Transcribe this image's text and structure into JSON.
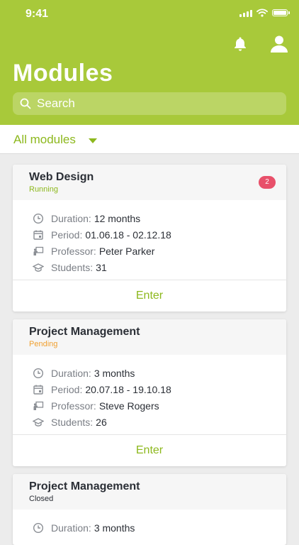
{
  "status_bar": {
    "time": "9:41"
  },
  "header": {
    "title": "Modules",
    "search_placeholder": "Search"
  },
  "filter": {
    "label": "All modules"
  },
  "labels": {
    "duration": "Duration:",
    "period": "Period:",
    "professor": "Professor:",
    "students": "Students:"
  },
  "colors": {
    "accent": "#a8c93a",
    "running": "#8db81d",
    "pending": "#f0a030",
    "closed": "#2b2f36",
    "badge": "#e8506a"
  },
  "modules": [
    {
      "title": "Web Design",
      "status": "Running",
      "badge": "2",
      "duration": "12 months",
      "period": "01.06.18 - 02.12.18",
      "professor": "Peter Parker",
      "students": "31",
      "action": "Enter"
    },
    {
      "title": "Project Management",
      "status": "Pending",
      "duration": "3 months",
      "period": "20.07.18 - 19.10.18",
      "professor": "Steve Rogers",
      "students": "26",
      "action": "Enter"
    },
    {
      "title": "Project Management",
      "status": "Closed",
      "duration": "3 months"
    }
  ]
}
